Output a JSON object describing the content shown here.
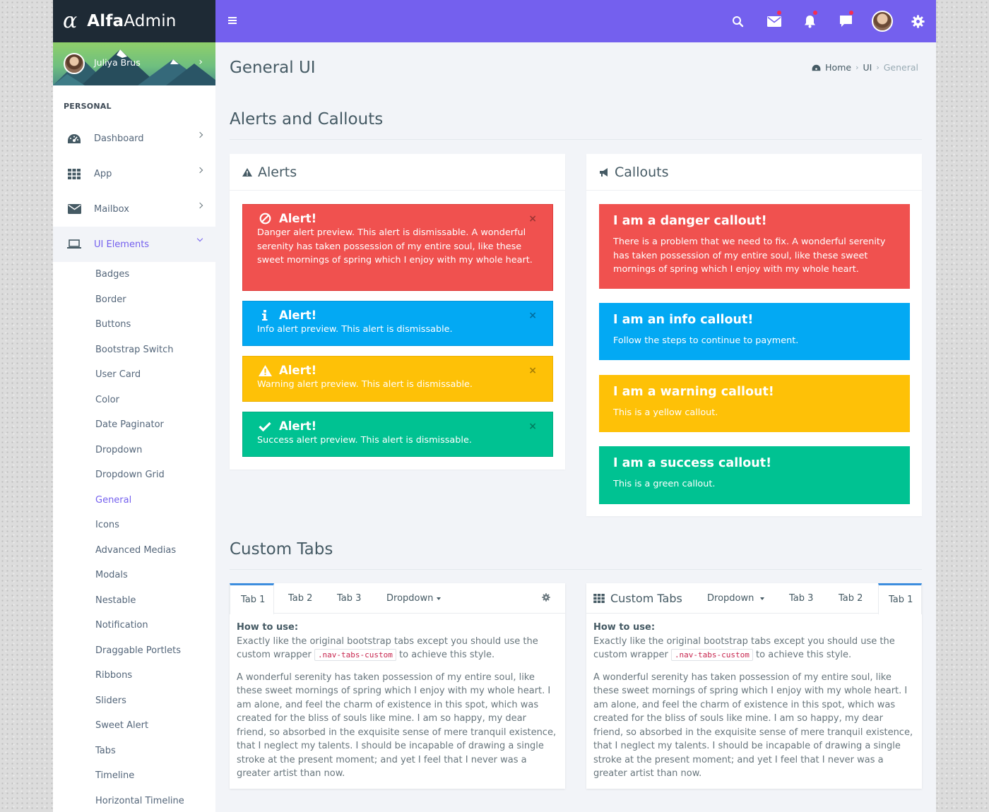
{
  "brand": {
    "name_bold": "Alfa",
    "name_light": "Admin"
  },
  "user": {
    "name": "Juliya Brus"
  },
  "sidebar": {
    "caption": "PERSONAL",
    "items": [
      {
        "label": "Dashboard"
      },
      {
        "label": "App"
      },
      {
        "label": "Mailbox"
      },
      {
        "label": "UI Elements"
      }
    ],
    "sub_items": [
      "Badges",
      "Border",
      "Buttons",
      "Bootstrap Switch",
      "User Card",
      "Color",
      "Date Paginator",
      "Dropdown",
      "Dropdown Grid",
      "General",
      "Icons",
      "Advanced Medias",
      "Modals",
      "Nestable",
      "Notification",
      "Draggable Portlets",
      "Ribbons",
      "Sliders",
      "Sweet Alert",
      "Tabs",
      "Timeline",
      "Horizontal Timeline"
    ]
  },
  "page": {
    "title": "General UI",
    "breadcrumb": {
      "home": "Home",
      "ui": "UI",
      "current": "General"
    }
  },
  "sections": {
    "alerts_callouts": "Alerts and Callouts",
    "custom_tabs": "Custom Tabs"
  },
  "alerts_box": {
    "title": "Alerts",
    "close": "×",
    "items": [
      {
        "type": "danger",
        "title": "Alert!",
        "body": "Danger alert preview. This alert is dismissable. A wonderful serenity has taken possession of my entire soul, like these sweet mornings of spring which I enjoy with my whole heart."
      },
      {
        "type": "info",
        "title": "Alert!",
        "body": "Info alert preview. This alert is dismissable."
      },
      {
        "type": "warning",
        "title": "Alert!",
        "body": "Warning alert preview. This alert is dismissable."
      },
      {
        "type": "success",
        "title": "Alert!",
        "body": "Success alert preview. This alert is dismissable."
      }
    ]
  },
  "callouts_box": {
    "title": "Callouts",
    "items": [
      {
        "type": "danger",
        "title": "I am a danger callout!",
        "body": "There is a problem that we need to fix. A wonderful serenity has taken possession of my entire soul, like these sweet mornings of spring which I enjoy with my whole heart."
      },
      {
        "type": "info",
        "title": "I am an info callout!",
        "body": "Follow the steps to continue to payment."
      },
      {
        "type": "warning",
        "title": "I am a warning callout!",
        "body": "This is a yellow callout."
      },
      {
        "type": "success",
        "title": "I am a success callout!",
        "body": "This is a green callout."
      }
    ]
  },
  "tabs_left": {
    "tabs": [
      "Tab 1",
      "Tab 2",
      "Tab 3"
    ],
    "dropdown": "Dropdown",
    "active_tab": "Tab 1"
  },
  "tabs_right": {
    "title": "Custom Tabs",
    "dropdown": "Dropdown",
    "tabs": [
      "Tab 3",
      "Tab 2",
      "Tab 1"
    ],
    "active_tab": "Tab 1"
  },
  "tab_content": {
    "howto": "How to use:",
    "line1": "Exactly like the original bootstrap tabs except you should use the custom wrapper",
    "code": ".nav-tabs-custom",
    "line1_end": "to achieve this style.",
    "para": "A wonderful serenity has taken possession of my entire soul, like these sweet mornings of spring which I enjoy with my whole heart. I am alone, and feel the charm of existence in this spot, which was created for the bliss of souls like mine. I am so happy, my dear friend, so absorbed in the exquisite sense of mere tranquil existence, that I neglect my talents. I should be incapable of drawing a single stroke at the present moment; and yet I feel that I never was a greater artist than now."
  },
  "colors": {
    "topbar": "#7460ee",
    "brand_bg": "#1e2a35",
    "danger": "#f0514f",
    "info": "#03a9f3",
    "warning": "#fec107",
    "success": "#00c292",
    "accent": "#7460ee"
  },
  "icons": {
    "topbar": [
      "search-icon",
      "mail-icon",
      "bell-icon",
      "chat-icon",
      "avatar",
      "gear-icon"
    ],
    "sidebar": [
      "dashboard-icon",
      "grid-icon",
      "envelope-icon",
      "laptop-icon"
    ]
  }
}
